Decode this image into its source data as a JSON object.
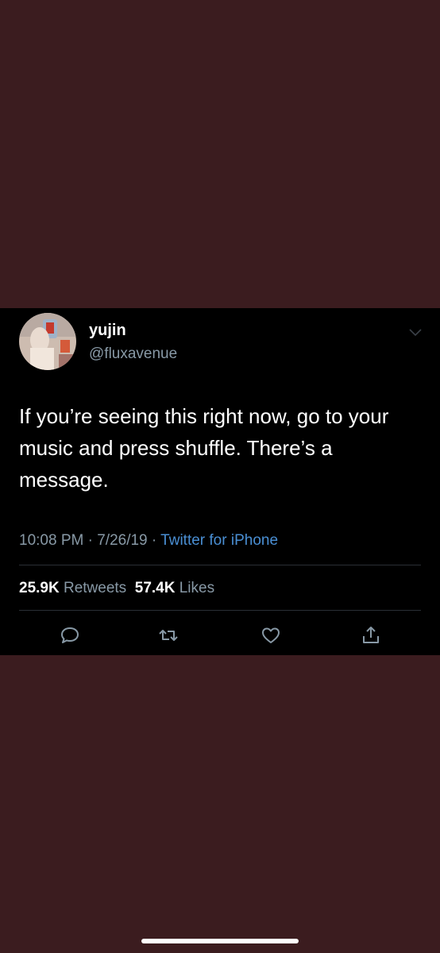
{
  "tweet": {
    "display_name": "yujin",
    "handle": "@fluxavenue",
    "text": "If you’re seeing this right now, go to your music and press shuffle. There’s a message.",
    "time": "10:08 PM",
    "date": "7/26/19",
    "separator": "·",
    "source": "Twitter for iPhone",
    "retweets_count": "25.9K",
    "retweets_label": "Retweets",
    "likes_count": "57.4K",
    "likes_label": "Likes"
  },
  "actions": [
    {
      "icon": "reply-icon"
    },
    {
      "icon": "retweet-icon"
    },
    {
      "icon": "like-icon"
    },
    {
      "icon": "share-icon"
    }
  ],
  "colors": {
    "page_background": "#3b1c1f",
    "card_background": "#000000",
    "secondary_text": "#8899a6",
    "link": "#4a8fd4"
  }
}
